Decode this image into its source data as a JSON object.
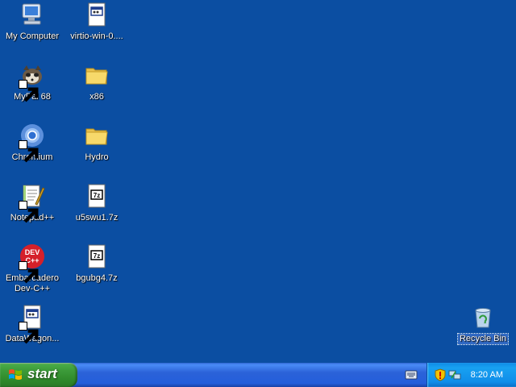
{
  "desktop": {
    "icons": [
      {
        "label": "My Computer",
        "icon": "computer-icon"
      },
      {
        "label": "virtio-win-0....",
        "icon": "installer-file-icon"
      },
      {
        "label": "MyPal 68",
        "icon": "mypal-icon",
        "shortcut": true
      },
      {
        "label": "x86",
        "icon": "folder-icon"
      },
      {
        "label": "Chromium",
        "icon": "chromium-icon",
        "shortcut": true
      },
      {
        "label": "Hydro",
        "icon": "folder-icon"
      },
      {
        "label": "Notepad++",
        "icon": "notepadpp-icon",
        "shortcut": true
      },
      {
        "label": "u5swu1.7z",
        "icon": "7z-file-icon"
      },
      {
        "label": "Embarcadero Dev-C++",
        "icon": "devcpp-icon",
        "shortcut": true
      },
      {
        "label": "bgubg4.7z",
        "icon": "7z-file-icon"
      },
      {
        "label": "DataWagon...",
        "icon": "installer-file-icon",
        "shortcut": true
      },
      {
        "label": "Recycle Bin",
        "icon": "recycle-bin-icon"
      }
    ]
  },
  "taskbar": {
    "start_label": "start",
    "clock": "8:20 AM"
  },
  "colors": {
    "desktop_bg": "#0b4ea2",
    "taskbar": "#245edb",
    "start_green": "#3d9c3a",
    "tray_blue": "#0f8de9"
  }
}
